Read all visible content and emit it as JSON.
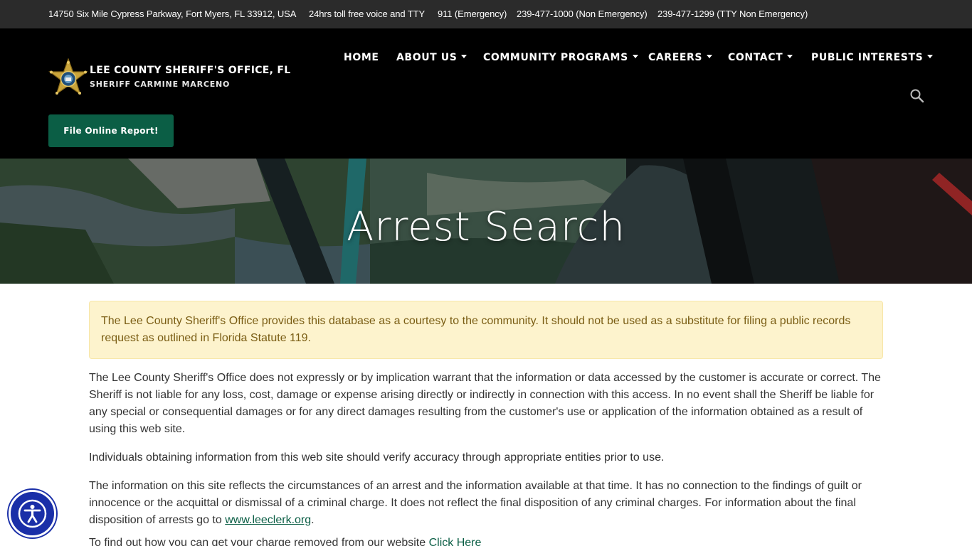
{
  "topbar": {
    "address": "14750 Six Mile Cypress Parkway, Fort Myers, FL 33912, USA",
    "tty": "24hrs toll free voice and TTY",
    "emergency": "911 (Emergency)",
    "non_emergency": "239-477-1000 (Non Emergency)",
    "tty_non_emergency": "239-477-1299 (TTY Non Emergency)"
  },
  "logo": {
    "title": "LEE COUNTY SHERIFF'S OFFICE, FL",
    "subtitle": "SHERIFF CARMINE MARCENO",
    "icon": "sheriff-star-badge-icon"
  },
  "nav": {
    "home": "HOME",
    "about": "ABOUT US",
    "community": "COMMUNITY PROGRAMS",
    "careers": "CAREERS",
    "contact": "CONTACT",
    "public": "PUBLIC INTERESTS",
    "search_icon": "search-icon"
  },
  "report_button": "File Online Report!",
  "hero": {
    "title": "Arrest Search"
  },
  "alert": "The Lee County Sheriff's Office provides this database as a courtesy to the community. It should not be used as a substitute for filing a public records request as outlined in Florida Statute 119.",
  "content": {
    "p1": "The Lee County Sheriff's Office does not expressly or by implication warrant that the information or data accessed by the customer is accurate or correct. The Sheriff is not liable for any loss, cost, damage or expense arising directly or indirectly in connection with this access. In no event shall the Sheriff be liable for any special or consequential damages or for any direct damages resulting from the customer's use or application of the information obtained as a result of using this web site.",
    "p2": "Individuals obtaining information from this web site should verify accuracy through appropriate entities prior to use.",
    "p3_text": "The information on this site reflects the circumstances of an arrest and the information available at that time. It has no connection to the findings of guilt or innocence or the acquittal or dismissal of a criminal charge. It does not reflect the final disposition of any criminal charges. For information about the final disposition of arrests go to ",
    "p3_link": "www.leeclerk.org",
    "p3_end": ".",
    "p4_text": "To find out how you can get your charge removed from our website ",
    "p4_link": "Click Here"
  },
  "accessibility_icon": "accessibility-icon",
  "colors": {
    "brand_green": "#0b5e45",
    "alert_bg": "#fdf3cd",
    "a11y_blue": "#1a2fa8"
  }
}
